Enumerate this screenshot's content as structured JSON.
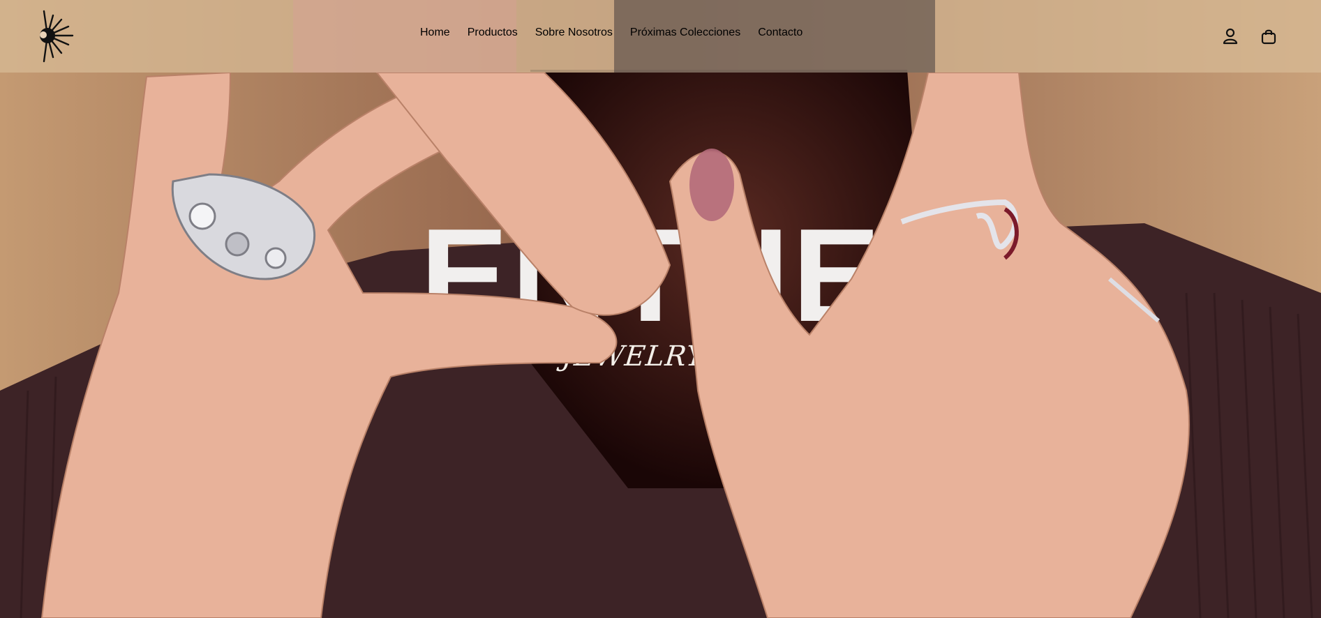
{
  "brand": {
    "logo_icon": "sun-eye-logo-icon"
  },
  "nav": {
    "items": [
      {
        "label": "Home"
      },
      {
        "label": "Productos"
      },
      {
        "label": "Sobre Nosotros"
      },
      {
        "label": "Próximas Colecciones"
      },
      {
        "label": "Contacto"
      }
    ]
  },
  "header_icons": {
    "account_icon": "user-icon",
    "cart_icon": "shopping-bag-icon"
  },
  "hero": {
    "title": "ENTHEO",
    "subtitle": "JEWELRY by E"
  },
  "colors": {
    "header_bg": "#d6b894",
    "nav_text": "#1c1a1a",
    "title_text": "#f1efee",
    "backdrop": "#c9a47c",
    "sweater": "#3d2326"
  }
}
